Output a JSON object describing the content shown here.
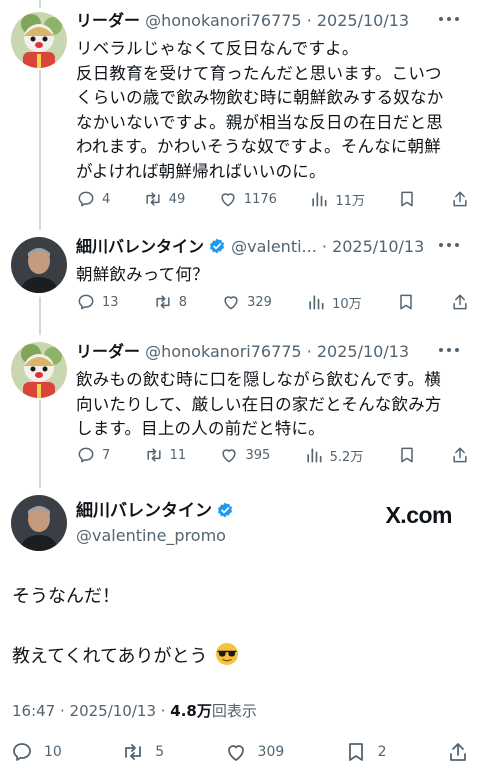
{
  "tweets": [
    {
      "name": "リーダー",
      "handle": "@honokanori76775",
      "date": "· 2025/10/13",
      "lines": [
        "リベラルじゃなくて反日なんですよ。",
        "反日教育を受けて育ったんだと思います。こいつ",
        "くらいの歳で飲み物飲む時に朝鮮飲みする奴なか",
        "なかいないですよ。親が相当な反日の在日だと思",
        "われます。かわいそうな奴ですよ。そんなに朝鮮",
        "がよければ朝鮮帰ればいいのに。"
      ],
      "replies": "4",
      "retweets": "49",
      "likes": "1176",
      "views": "11万"
    },
    {
      "name": "細川バレンタイン",
      "handle": "@valenti...",
      "date": "· 2025/10/13",
      "lines": [
        "朝鮮飲みって何？"
      ],
      "replies": "13",
      "retweets": "8",
      "likes": "329",
      "views": "10万"
    },
    {
      "name": "リーダー",
      "handle": "@honokanori76775",
      "date": "· 2025/10/13",
      "lines": [
        "飲みもの飲む時に口を隠しながら飲むんです。横",
        "向いたりして、厳しい在日の家だとそんな飲み方",
        "します。目上の人の前だと特に。"
      ],
      "replies": "7",
      "retweets": "11",
      "likes": "395",
      "views": "5.2万"
    }
  ],
  "main": {
    "name": "細川バレンタイン",
    "handle": "@valentine_promo",
    "watermark": "X.com",
    "line1": "そうなんだ！",
    "line2": "教えてくれてありがとう",
    "time": "16:47 · 2025/10/13 · ",
    "views_count": "4.8万",
    "views_label": "回表示",
    "replies": "10",
    "retweets": "5",
    "likes": "309",
    "bookmarks": "2"
  },
  "colors": {
    "verified": "#1d9bf0",
    "muted": "#536471",
    "line": "#cfd9de"
  }
}
